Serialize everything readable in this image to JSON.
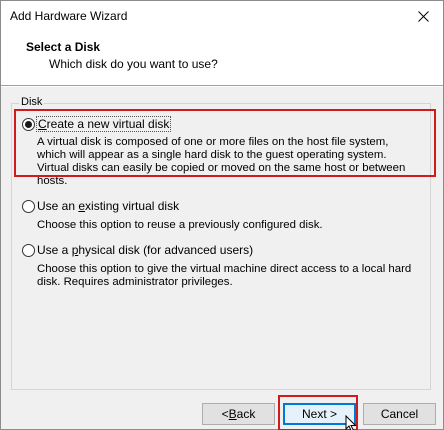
{
  "window": {
    "title": "Add Hardware Wizard"
  },
  "header": {
    "title": "Select a Disk",
    "subtitle": "Which disk do you want to use?"
  },
  "group": {
    "label": "Disk"
  },
  "options": [
    {
      "label_prefix": "",
      "label_access": "C",
      "label_rest": "reate a new virtual disk",
      "checked": true,
      "desc": "A virtual disk is composed of one or more files on the host file system, which will appear as a single hard disk to the guest operating system. Virtual disks can easily be copied or moved on the same host or between hosts."
    },
    {
      "label_prefix": "Use an ",
      "label_access": "e",
      "label_rest": "xisting virtual disk",
      "checked": false,
      "desc": "Choose this option to reuse a previously configured disk."
    },
    {
      "label_prefix": "Use a ",
      "label_access": "p",
      "label_rest": "hysical disk (for advanced users)",
      "checked": false,
      "desc": "Choose this option to give the virtual machine direct access to a local hard disk. Requires administrator privileges."
    }
  ],
  "buttons": {
    "back_prefix": "< ",
    "back_access": "B",
    "back_rest": "ack",
    "next": "Next >",
    "cancel": "Cancel"
  },
  "colors": {
    "highlight": "#d11a1a",
    "default_button_border": "#0078d7"
  }
}
